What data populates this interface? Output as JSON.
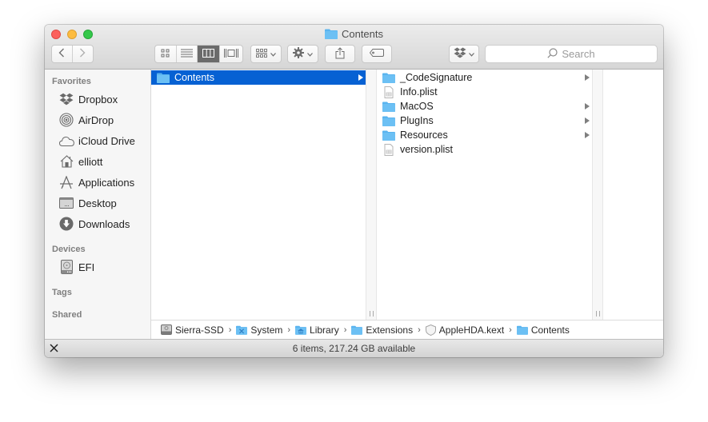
{
  "window": {
    "title": "Contents"
  },
  "toolbar": {
    "back_icon": "chevron-left-icon",
    "forward_icon": "chevron-right-icon",
    "view_modes": [
      {
        "name": "icon-view",
        "active": false
      },
      {
        "name": "list-view",
        "active": false
      },
      {
        "name": "column-view",
        "active": true
      },
      {
        "name": "cover-flow-view",
        "active": false
      }
    ],
    "arrange_icon": "arrange-grid-icon",
    "action_icon": "gear-icon",
    "share_icon": "share-icon",
    "tags_icon": "tag-icon",
    "dropbox_icon": "dropbox-icon",
    "search_placeholder": "Search"
  },
  "sidebar": {
    "sections": [
      {
        "heading": "Favorites",
        "items": [
          {
            "label": "Dropbox",
            "icon": "dropbox-icon"
          },
          {
            "label": "AirDrop",
            "icon": "airdrop-icon"
          },
          {
            "label": "iCloud Drive",
            "icon": "cloud-icon"
          },
          {
            "label": "elliott",
            "icon": "home-icon"
          },
          {
            "label": "Applications",
            "icon": "applications-icon"
          },
          {
            "label": "Desktop",
            "icon": "desktop-icon"
          },
          {
            "label": "Downloads",
            "icon": "downloads-icon"
          }
        ]
      },
      {
        "heading": "Devices",
        "items": [
          {
            "label": "EFI",
            "icon": "disk-icon"
          }
        ]
      },
      {
        "heading": "Tags",
        "items": []
      },
      {
        "heading": "Shared",
        "items": []
      }
    ]
  },
  "columns": [
    {
      "items": [
        {
          "name": "Contents",
          "type": "folder",
          "has_children": true,
          "selected": true
        }
      ]
    },
    {
      "items": [
        {
          "name": "_CodeSignature",
          "type": "folder",
          "has_children": true,
          "selected": false
        },
        {
          "name": "Info.plist",
          "type": "plist",
          "has_children": false,
          "selected": false
        },
        {
          "name": "MacOS",
          "type": "folder",
          "has_children": true,
          "selected": false
        },
        {
          "name": "PlugIns",
          "type": "folder",
          "has_children": true,
          "selected": false
        },
        {
          "name": "Resources",
          "type": "folder",
          "has_children": true,
          "selected": false
        },
        {
          "name": "version.plist",
          "type": "plist",
          "has_children": false,
          "selected": false
        }
      ]
    },
    {
      "items": []
    }
  ],
  "pathbar": {
    "crumbs": [
      {
        "label": "Sierra-SSD",
        "icon": "hard-drive-icon"
      },
      {
        "label": "System",
        "icon": "system-folder-icon"
      },
      {
        "label": "Library",
        "icon": "library-folder-icon"
      },
      {
        "label": "Extensions",
        "icon": "folder-icon"
      },
      {
        "label": "AppleHDA.kext",
        "icon": "kext-icon"
      },
      {
        "label": "Contents",
        "icon": "folder-icon"
      }
    ],
    "separator": "›"
  },
  "statusbar": {
    "text": "6 items, 217.24 GB available",
    "tool_icon": "tools-icon"
  },
  "colors": {
    "selection": "#0661d3",
    "folder": "#5ab4ef",
    "close": "#fc605c",
    "minimize": "#fdbc40",
    "maximize": "#34c84a"
  }
}
